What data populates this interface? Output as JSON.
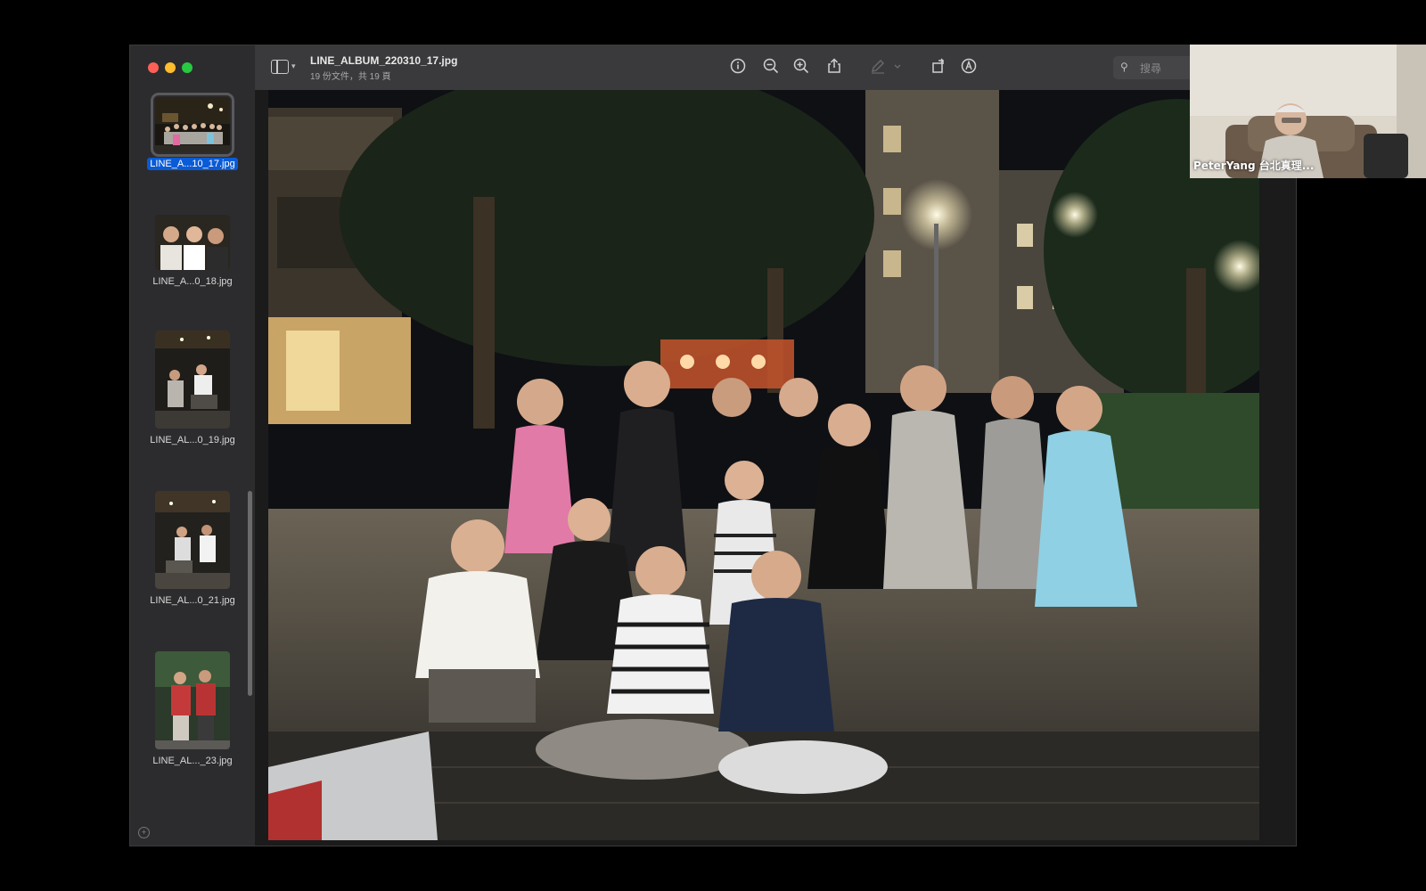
{
  "window": {
    "title": "LINE_ALBUM_220310_17.jpg",
    "subtitle": "19 份文件，共 19 頁"
  },
  "sidebar": {
    "thumbnails": [
      {
        "caption": "LINE_A...10_17.jpg",
        "selected": true
      },
      {
        "caption": "LINE_A...0_18.jpg",
        "selected": false
      },
      {
        "caption": "LINE_AL...0_19.jpg",
        "selected": false
      },
      {
        "caption": "LINE_AL...0_21.jpg",
        "selected": false
      },
      {
        "caption": "LINE_AL..._23.jpg",
        "selected": false
      }
    ]
  },
  "toolbar": {
    "icons": [
      "sidebar-toggle-icon",
      "info-icon",
      "zoom-out-icon",
      "zoom-in-icon",
      "share-icon",
      "markup-pen-icon",
      "rotate-icon",
      "annotate-icon",
      "search-icon"
    ],
    "search_placeholder": "搜尋"
  },
  "video_call": {
    "participant_name": "PeterYang 台北真理..."
  },
  "colors": {
    "accent": "#0a5bd6",
    "close": "#ff5f57",
    "minimize": "#febc2e",
    "zoom": "#28c840"
  }
}
